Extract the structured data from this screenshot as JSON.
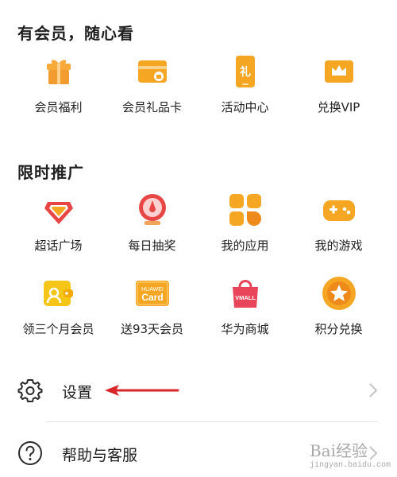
{
  "member": {
    "title": "有会员，随心看",
    "items": [
      {
        "label": "会员福利",
        "icon": "gift-icon"
      },
      {
        "label": "会员礼品卡",
        "icon": "gift-card-icon"
      },
      {
        "label": "活动中心",
        "icon": "phone-event-icon"
      },
      {
        "label": "兑换VIP",
        "icon": "crown-card-icon"
      }
    ]
  },
  "promo": {
    "title": "限时推广",
    "items": [
      {
        "label": "超话广场",
        "icon": "diamond-icon"
      },
      {
        "label": "每日抽奖",
        "icon": "lottery-icon"
      },
      {
        "label": "我的应用",
        "icon": "apps-icon"
      },
      {
        "label": "我的游戏",
        "icon": "gamepad-icon"
      },
      {
        "label": "领三个月会员",
        "icon": "wallet-icon"
      },
      {
        "label": "送93天会员",
        "icon": "huawei-card-icon"
      },
      {
        "label": "华为商城",
        "icon": "vmall-bag-icon"
      },
      {
        "label": "积分兑换",
        "icon": "star-medal-icon"
      }
    ]
  },
  "huawei_card": {
    "line1": "HUAWEI",
    "line2": "Card"
  },
  "vmall_text": "VMALL",
  "phone_char": "礼",
  "settings": {
    "label": "设置"
  },
  "help": {
    "label": "帮助与客服"
  },
  "watermark": {
    "main": "Bai经验",
    "sub": "jingyan.baidu.com"
  },
  "colors": {
    "orange": "#f5a623",
    "orange_dark": "#ee8a1a",
    "red": "#e63c3c",
    "arrow": "#d9262b"
  }
}
